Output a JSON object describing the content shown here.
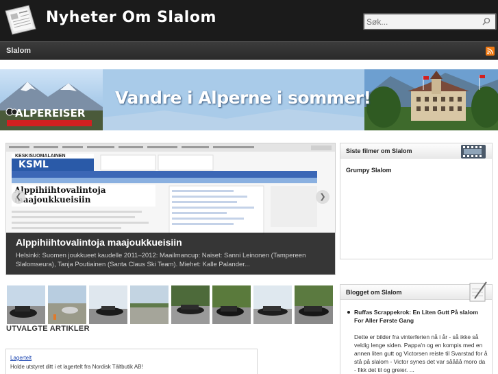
{
  "header": {
    "title": "Nyheter Om Slalom",
    "search_placeholder": "Søk..."
  },
  "nav": {
    "items": [
      "Slalom"
    ]
  },
  "banner": {
    "headline": "Vandre i Alperne i sommer!",
    "brand": "ALPEREISER"
  },
  "slider": {
    "title": "Alppihiihtovalintoja maajoukkueisiin",
    "text": "Helsinki: Suomen joukkueet kaudelle 2011–2012: Maailmancup: Naiset: Sanni Leinonen (Tampereen Slalomseura), Tanja Poutiainen (Santa Claus Ski Team). Miehet: Kalle Palander...",
    "shot_logo": "KSML",
    "shot_header": "KESKISUOMALAINEN",
    "shot_headline": "Alppihiihtovalintoja maajoukkueisiin"
  },
  "featured": {
    "heading": "UTVALGTE ARTIKLER",
    "link": "Lagertelt",
    "text": "Holde utstyret ditt i et lagertelt fra Nordisk Tältbutik AB!"
  },
  "sidebar": {
    "films": {
      "title": "Siste filmer om Slalom",
      "items": [
        "Grumpy Slalom"
      ]
    },
    "blog": {
      "title": "Blogget om Slalom",
      "post_title": "Ruffas Scrappekrok: En Liten Gutt På slalom For Aller Første Gang",
      "post_text": "Dette er bilder fra vinterferien nå i år - så ikke så veldig lenge siden. Pappa'n og en kompis med en annen liten gutt og Victorsen reiste til Svarstad for å stå på slalom - Victor synes det var såååå moro da - fikk det til og greier. ..."
    }
  }
}
